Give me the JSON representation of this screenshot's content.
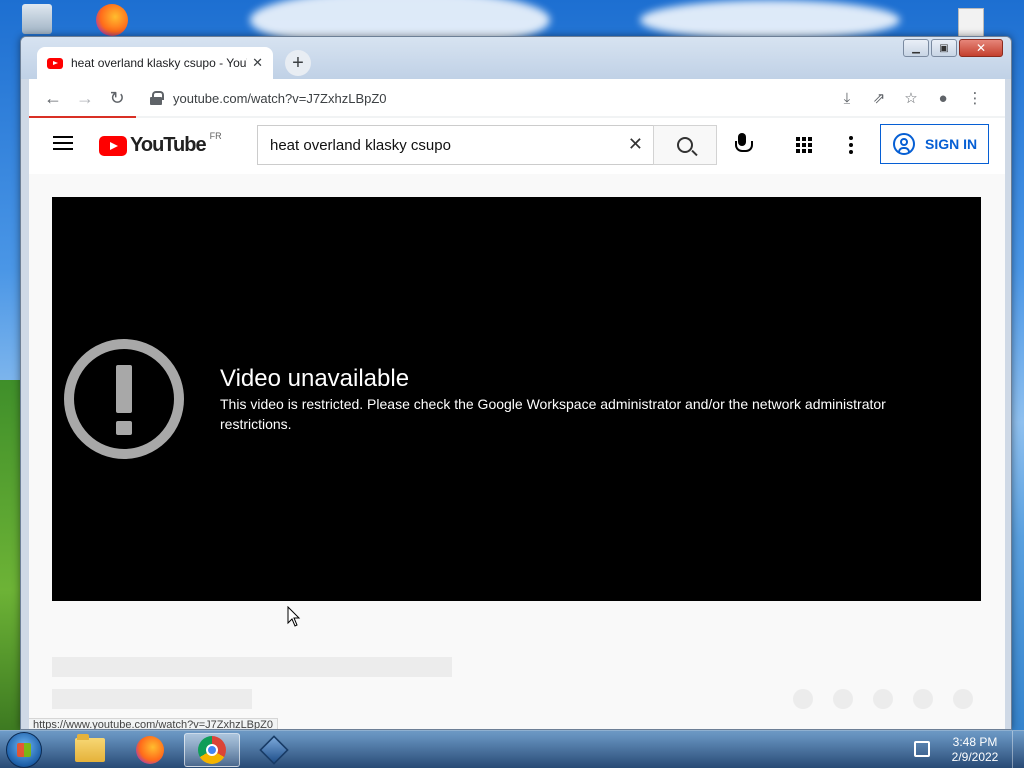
{
  "browser": {
    "tab_title": "heat overland klasky csupo - YouTube",
    "url": "youtube.com/watch?v=J7ZxhzLBpZ0",
    "status_url": "https://www.youtube.com/watch?v=J7ZxhzLBpZ0",
    "load_progress": 0.11
  },
  "youtube": {
    "logo_text": "YouTube",
    "country_code": "FR",
    "search_query": "heat overland klasky csupo",
    "sign_in_label": "SIGN IN",
    "error_title": "Video unavailable",
    "error_message": "This video is restricted. Please check the Google Workspace administrator and/or the network administrator restrictions."
  },
  "taskbar": {
    "time": "3:48 PM",
    "date": "2/9/2022"
  },
  "colors": {
    "youtube_red": "#ff0000",
    "link_blue": "#065fd4"
  },
  "icons": [
    "back-arrow-icon",
    "forward-arrow-icon",
    "reload-icon",
    "lock-icon",
    "install-icon",
    "share-icon",
    "star-icon",
    "profile-icon",
    "menu-icon",
    "search-icon",
    "clear-icon",
    "mic-icon",
    "apps-grid-icon",
    "more-options-icon",
    "account-icon",
    "error-exclamation-icon"
  ]
}
